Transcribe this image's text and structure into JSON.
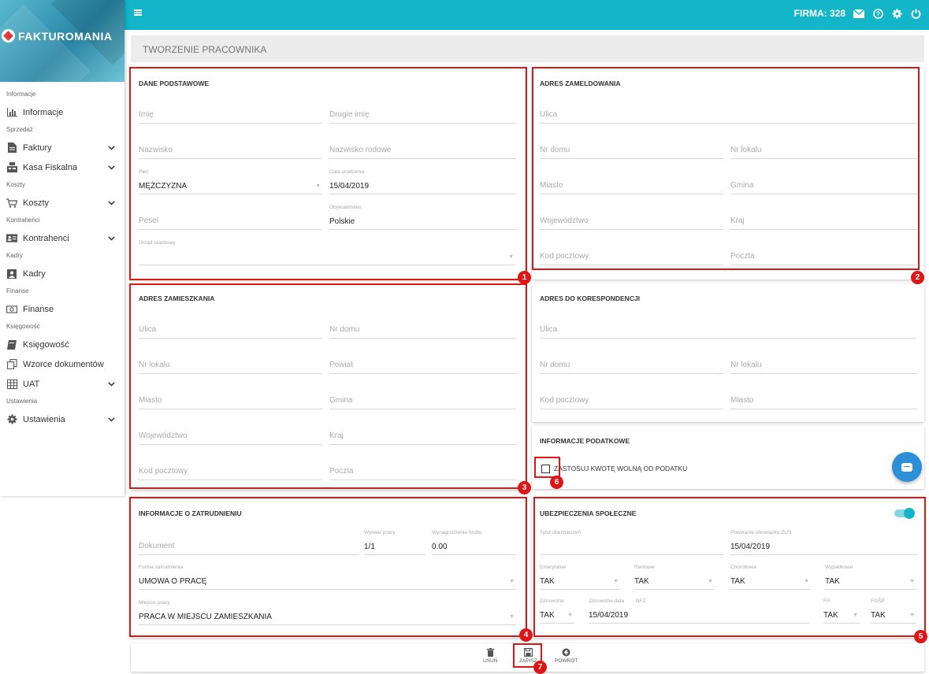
{
  "sidebar": {
    "logo_text": "FAKTUROMANIA",
    "items": [
      {
        "type": "section",
        "label": "Informacje"
      },
      {
        "type": "item",
        "label": "Informacje",
        "icon": "bar-chart-icon",
        "chev": false
      },
      {
        "type": "section",
        "label": "Sprzedaż"
      },
      {
        "type": "item",
        "label": "Faktury",
        "icon": "document-icon",
        "chev": true
      },
      {
        "type": "item",
        "label": "Kasa Fiskalna",
        "icon": "cash-register-icon",
        "chev": true
      },
      {
        "type": "section",
        "label": "Koszty"
      },
      {
        "type": "item",
        "label": "Koszty",
        "icon": "cart-icon",
        "chev": true
      },
      {
        "type": "section",
        "label": "Kontrahenci"
      },
      {
        "type": "item",
        "label": "Kontrahenci",
        "icon": "id-card-icon",
        "chev": true
      },
      {
        "type": "section",
        "label": "Kadry"
      },
      {
        "type": "item",
        "label": "Kadry",
        "icon": "person-icon",
        "chev": false
      },
      {
        "type": "section",
        "label": "Finanse"
      },
      {
        "type": "item",
        "label": "Finanse",
        "icon": "money-icon",
        "chev": false
      },
      {
        "type": "section",
        "label": "Księgowość"
      },
      {
        "type": "item",
        "label": "Księgowość",
        "icon": "book-icon",
        "chev": false
      },
      {
        "type": "item",
        "label": "Wzorce dokumentów",
        "icon": "copy-icon",
        "chev": false
      },
      {
        "type": "item",
        "label": "UAT",
        "icon": "grid-icon",
        "chev": true
      },
      {
        "type": "section",
        "label": "Ustawienia"
      },
      {
        "type": "item",
        "label": "Ustawienia",
        "icon": "gear-icon",
        "chev": true
      }
    ]
  },
  "topbar": {
    "firma": "FIRMA: 328",
    "icons": [
      "mail-icon",
      "help-icon",
      "settings-icon",
      "power-icon"
    ]
  },
  "page_title": "TWORZENIE PRACOWNIKA",
  "sections": {
    "dane": {
      "title": "DANE PODSTAWOWE",
      "fields": [
        {
          "ph": "Imię"
        },
        {
          "ph": "Drugie imię"
        },
        {
          "ph": "Nazwisko"
        },
        {
          "ph": "Nazwisko rodowe"
        },
        {
          "label": "Płeć",
          "value": "MĘŻCZYZNA",
          "dd": true
        },
        {
          "label": "Data urodzenia",
          "value": "15/04/2019"
        },
        {
          "ph": "Pesel"
        },
        {
          "label": "Obywatelstwo",
          "value": "Polskie"
        },
        {
          "label": "Urząd skarbowy",
          "value": "",
          "dd": true
        }
      ]
    },
    "zameld": {
      "title": "ADRES ZAMELDOWANIA",
      "fields": [
        {
          "ph": "Ulica"
        },
        {
          "ph": "Nr domu"
        },
        {
          "ph": "Nr lokalu"
        },
        {
          "ph": "Miasto"
        },
        {
          "ph": "Gmina"
        },
        {
          "ph": "Województwo"
        },
        {
          "ph": "Kraj"
        },
        {
          "ph": "Kod pocztowy"
        },
        {
          "ph": "Poczta"
        }
      ]
    },
    "zamieszk": {
      "title": "ADRES ZAMIESZKANIA",
      "fields": [
        {
          "ph": "Ulica"
        },
        {
          "ph": "Nr domu"
        },
        {
          "ph": "Nr lokalu"
        },
        {
          "ph": "Powiat"
        },
        {
          "ph": "Miasto"
        },
        {
          "ph": "Gmina"
        },
        {
          "ph": "Województwo"
        },
        {
          "ph": "Kraj"
        },
        {
          "ph": "Kod pocztowy"
        },
        {
          "ph": "Poczta"
        }
      ]
    },
    "koresp": {
      "title": "ADRES DO KORESPONDENCJI",
      "fields": [
        {
          "ph": "Ulica"
        },
        {
          "ph": "Nr domu"
        },
        {
          "ph": "Nr lokalu"
        },
        {
          "ph": "Kod pocztowy"
        },
        {
          "ph": "Miasto"
        }
      ]
    },
    "podatk": {
      "title": "INFORMACJE PODATKOWE",
      "checkbox_label": "ZASTOSUJ KWOTĘ WOLNĄ OD PODATKU"
    },
    "zatrud": {
      "title": "INFORMACJE O ZATRUDNIENIU",
      "fields": [
        {
          "ph": "Dokument"
        },
        {
          "label": "Wymiar pracy",
          "value": "1/1"
        },
        {
          "label": "Wynagrodzenie brutto",
          "value": "0.00"
        },
        {
          "label": "Forma zatrudnienia",
          "value": "UMOWA O PRACĘ",
          "dd": true
        },
        {
          "label": "Miejsce pracy",
          "value": "PRACA W MIEJSCU ZAMIESZKANIA",
          "dd": true
        }
      ]
    },
    "ubezp": {
      "title": "UBEZPIECZENIA SPOŁECZNE",
      "fields": [
        {
          "ph": "Tytuł ubezpieczeń",
          "small": true
        },
        {
          "label": "Powstanie obowiązku ZUS",
          "value": "15/04/2019"
        },
        {
          "label": "Emerytalne",
          "value": "TAK",
          "dd": true
        },
        {
          "label": "Rentowe",
          "value": "TAK",
          "dd": true
        },
        {
          "label": "Chorobowe",
          "value": "TAK",
          "dd": true
        },
        {
          "label": "Wypadkowe",
          "value": "TAK",
          "dd": true
        },
        {
          "label": "Zdrowotne",
          "value": "TAK",
          "dd": true
        },
        {
          "label": "Zdrowotne data",
          "value": "15/04/2019"
        },
        {
          "label": "NFZ",
          "value": ""
        },
        {
          "label": "FP",
          "value": "TAK",
          "dd": true
        },
        {
          "label": "FGŚP",
          "value": "TAK",
          "dd": true
        }
      ]
    }
  },
  "actions": [
    {
      "label": "USUŃ",
      "icon": "trash-icon"
    },
    {
      "label": "ZAPISZ",
      "icon": "save-icon"
    },
    {
      "label": "POWRÓT",
      "icon": "back-arrow-icon"
    }
  ],
  "badges": [
    "1",
    "2",
    "3",
    "4",
    "5",
    "6",
    "7"
  ],
  "colors": {
    "topbar": "#13b5c9",
    "highlight": "#e01515"
  }
}
